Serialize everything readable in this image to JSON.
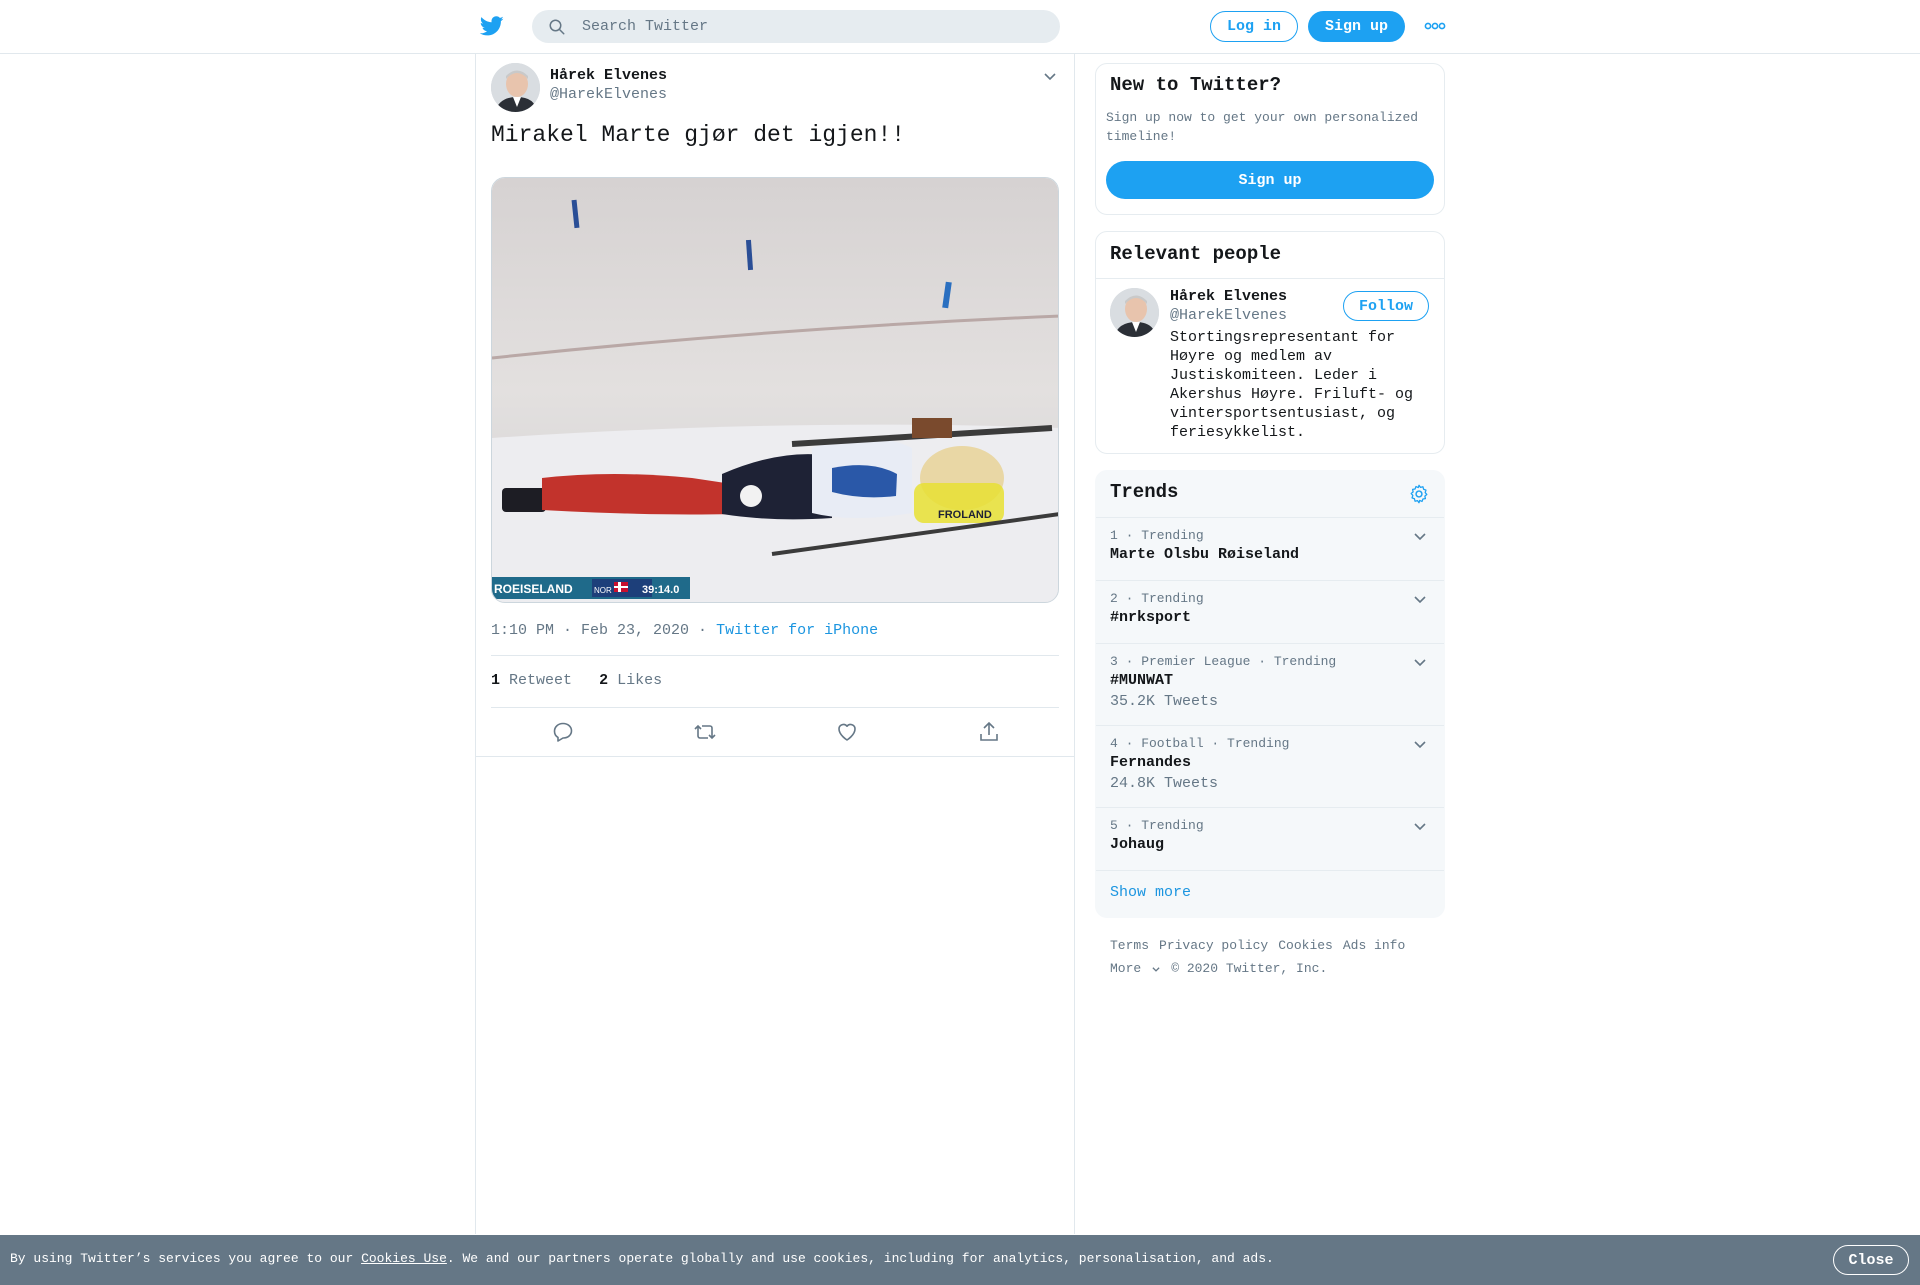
{
  "topbar": {
    "logo_icon": "twitter-bird-icon",
    "search_placeholder": "Search Twitter",
    "login_label": "Log in",
    "signup_label": "Sign up",
    "more_icon": "more-dots-icon"
  },
  "tweet": {
    "author_name": "Hårek Elvenes",
    "author_handle": "@HarekElvenes",
    "text": "Mirakel Marte gjør det igjen!!",
    "time": "1:10 PM · Feb 23, 2020",
    "separator": " · ",
    "source": "Twitter for iPhone",
    "retweet_count": "1",
    "retweet_label": "Retweet",
    "likes_count": "2",
    "likes_label": "Likes",
    "media_caption_name": "ROEISELAND",
    "media_caption_country": "NOR",
    "media_caption_time": "39:14.0",
    "media_bib_name": "FROLAND",
    "actions": [
      "reply-icon",
      "retweet-icon",
      "like-icon",
      "share-icon"
    ]
  },
  "sidebar": {
    "new_to_twitter": {
      "title": "New to Twitter?",
      "description": "Sign up now to get your own personalized timeline!",
      "button": "Sign up"
    },
    "relevant_people": {
      "title": "Relevant people",
      "name": "Hårek Elvenes",
      "handle": "@HarekElvenes",
      "follow_label": "Follow",
      "bio": "Stortingsrepresentant for Høyre og medlem av Justiskomiteen. Leder i Akershus Høyre. Friluft- og vintersportsentusiast, og feriesykkelist."
    },
    "trends": {
      "title": "Trends",
      "items": [
        {
          "meta": "1 · Trending",
          "name": "Marte Olsbu Røiseland",
          "count": ""
        },
        {
          "meta": "2 · Trending",
          "name": "#nrksport",
          "count": ""
        },
        {
          "meta": "3 · Premier League · Trending",
          "name": "#MUNWAT",
          "count": "35.2K Tweets"
        },
        {
          "meta": "4 · Football · Trending",
          "name": "Fernandes",
          "count": "24.8K Tweets"
        },
        {
          "meta": "5 · Trending",
          "name": "Johaug",
          "count": ""
        }
      ],
      "show_more": "Show more"
    },
    "footer": {
      "terms": "Terms",
      "privacy": "Privacy policy",
      "cookies": "Cookies",
      "ads": "Ads info",
      "more": "More",
      "copyright": "© 2020 Twitter, Inc."
    }
  },
  "cookie_bar": {
    "text_before": "By using Twitter’s services you agree to our ",
    "link": "Cookies Use",
    "text_after": ". We and our partners operate globally and use cookies, including for analytics, personalisation, and ads.",
    "close_label": "Close"
  },
  "colors": {
    "accent": "#1da1f2",
    "link": "#1b95e0",
    "muted": "#657786",
    "cookie_bar": "#657786"
  }
}
